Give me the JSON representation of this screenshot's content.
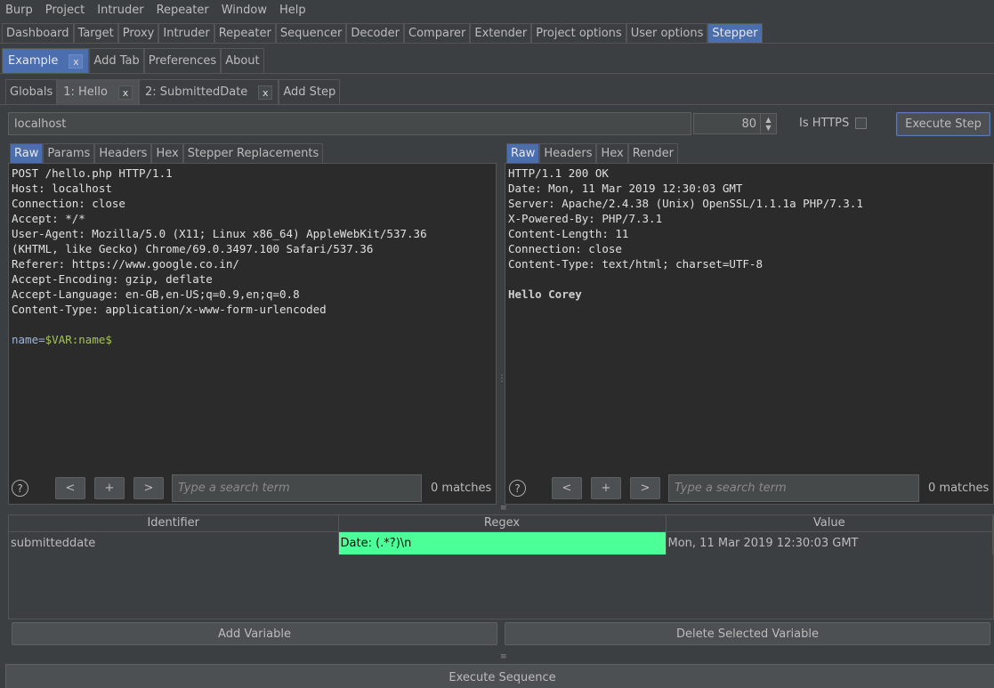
{
  "menu": [
    "Burp",
    "Project",
    "Intruder",
    "Repeater",
    "Window",
    "Help"
  ],
  "main_tabs": [
    {
      "label": "Dashboard",
      "active": false
    },
    {
      "label": "Target",
      "active": false
    },
    {
      "label": "Proxy",
      "active": false
    },
    {
      "label": "Intruder",
      "active": false
    },
    {
      "label": "Repeater",
      "active": false
    },
    {
      "label": "Sequencer",
      "active": false
    },
    {
      "label": "Decoder",
      "active": false
    },
    {
      "label": "Comparer",
      "active": false
    },
    {
      "label": "Extender",
      "active": false
    },
    {
      "label": "Project options",
      "active": false
    },
    {
      "label": "User options",
      "active": false
    },
    {
      "label": "Stepper",
      "active": true
    }
  ],
  "sequence_tabs": {
    "current": "Example",
    "close": "x",
    "add_tab": "Add Tab",
    "preferences": "Preferences",
    "about": "About"
  },
  "step_tabs": {
    "globals": "Globals",
    "step1": "1: Hello",
    "step2": "2: SubmittedDate",
    "close": "x",
    "add_step": "Add Step"
  },
  "target": {
    "host": "localhost",
    "port": "80",
    "is_https_label": "Is HTTPS",
    "is_https": false,
    "execute_step": "Execute Step"
  },
  "request": {
    "tabs": [
      "Raw",
      "Params",
      "Headers",
      "Hex",
      "Stepper Replacements"
    ],
    "active_tab": "Raw",
    "lines": [
      "POST /hello.php HTTP/1.1",
      "Host: localhost",
      "Connection: close",
      "Accept: */*",
      "User-Agent: Mozilla/5.0 (X11; Linux x86_64) AppleWebKit/537.36",
      "(KHTML, like Gecko) Chrome/69.0.3497.100 Safari/537.36",
      "Referer: https://www.google.co.in/",
      "Accept-Encoding: gzip, deflate",
      "Accept-Language: en-GB,en-US;q=0.9,en;q=0.8",
      "Content-Type: application/x-www-form-urlencoded",
      ""
    ],
    "body_param": "name=",
    "body_var": "$VAR:name$",
    "search_placeholder": "Type a search term",
    "matches": "0 matches"
  },
  "response": {
    "tabs": [
      "Raw",
      "Headers",
      "Hex",
      "Render"
    ],
    "active_tab": "Raw",
    "lines": [
      "HTTP/1.1 200 OK",
      "Date: Mon, 11 Mar 2019 12:30:03 GMT",
      "Server: Apache/2.4.38 (Unix) OpenSSL/1.1.1a PHP/7.3.1",
      "X-Powered-By: PHP/7.3.1",
      "Content-Length: 11",
      "Connection: close",
      "Content-Type: text/html; charset=UTF-8",
      ""
    ],
    "body": "Hello Corey",
    "search_placeholder": "Type a search term",
    "matches": "0 matches"
  },
  "nav_buttons": {
    "prev": "<",
    "add": "+",
    "next": ">",
    "help": "?"
  },
  "variables": {
    "headers": [
      "Identifier",
      "Regex",
      "Value"
    ],
    "rows": [
      {
        "identifier": "submitteddate",
        "regex": "Date: (.*?)\\n",
        "value": "Mon, 11 Mar 2019 12:30:03 GMT"
      }
    ],
    "add_button": "Add Variable",
    "delete_button": "Delete Selected Variable"
  },
  "execute_sequence": "Execute Sequence",
  "colors": {
    "background": "#3c3f41",
    "editor_bg": "#2b2b2b",
    "active_tab": "#4b6eaf",
    "regex_highlight": "#4cff96",
    "var_highlight": "#a5c25c"
  }
}
